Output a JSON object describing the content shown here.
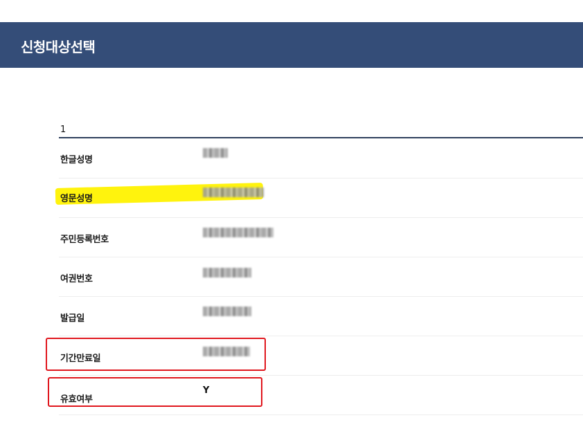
{
  "header": {
    "title": "신청대상선택"
  },
  "record": {
    "index": "1"
  },
  "fields": [
    {
      "label": "한글성명",
      "value": null
    },
    {
      "label": "영문성명",
      "value": null
    },
    {
      "label": "주민등록번호",
      "value": null
    },
    {
      "label": "여권번호",
      "value": null
    },
    {
      "label": "발급일",
      "value": null
    },
    {
      "label": "기간만료일",
      "value": null
    },
    {
      "label": "유효여부",
      "value": "Y"
    }
  ],
  "colors": {
    "header_bg": "#344d78",
    "highlight": "#fff200",
    "annotation_red": "#e0161d"
  }
}
